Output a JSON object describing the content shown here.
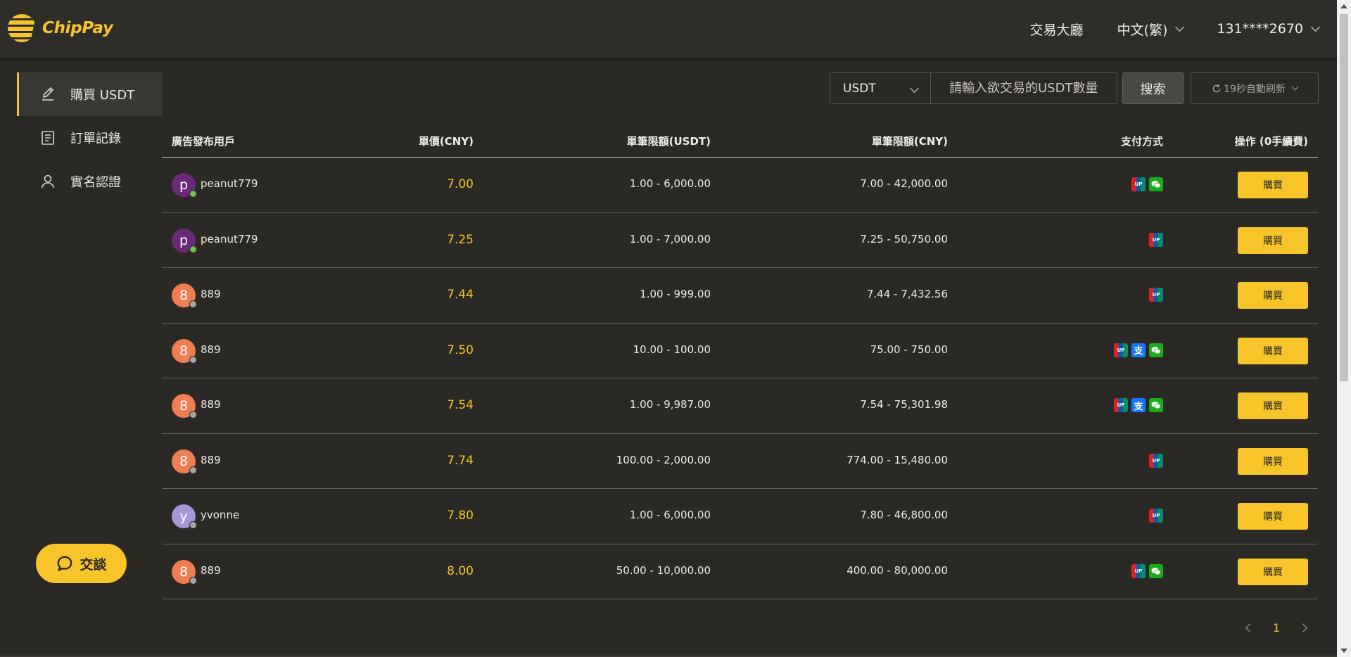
{
  "brand": {
    "name": "ChipPay",
    "accent": "#f7c52a"
  },
  "header": {
    "nav_trading_hall": "交易大廳",
    "language": "中文(繁)",
    "account": "131****2670"
  },
  "sidebar": {
    "items": [
      {
        "label": "購買 USDT",
        "icon": "edit-icon",
        "active": true
      },
      {
        "label": "訂單記錄",
        "icon": "document-icon",
        "active": false
      },
      {
        "label": "實名認證",
        "icon": "user-icon",
        "active": false
      }
    ]
  },
  "chat": {
    "label": "交談"
  },
  "filters": {
    "currency": "USDT",
    "amount_placeholder": "請輸入欲交易的USDT數量",
    "search_label": "搜索",
    "refresh_label": "19秒自動刷新"
  },
  "table": {
    "headers": {
      "advertiser": "廣告發布用戶",
      "price": "單價(CNY)",
      "limit_usdt": "單筆限額(USDT)",
      "limit_cny": "單筆限額(CNY)",
      "payment": "支付方式",
      "action": "操作 (0手續費)"
    },
    "buy_label": "購買",
    "rows": [
      {
        "initial": "p",
        "avatar_color": "#6b2a78",
        "online": true,
        "user": "peanut779",
        "price": "7.00",
        "limit_usdt": "1.00 - 6,000.00",
        "limit_cny": "7.00 - 42,000.00",
        "payments": [
          "unionpay",
          "wechat"
        ]
      },
      {
        "initial": "p",
        "avatar_color": "#6b2a78",
        "online": true,
        "user": "peanut779",
        "price": "7.25",
        "limit_usdt": "1.00 - 7,000.00",
        "limit_cny": "7.25 - 50,750.00",
        "payments": [
          "unionpay"
        ]
      },
      {
        "initial": "8",
        "avatar_color": "#ee7d52",
        "online": false,
        "user": "889",
        "price": "7.44",
        "limit_usdt": "1.00 - 999.00",
        "limit_cny": "7.44 - 7,432.56",
        "payments": [
          "unionpay"
        ]
      },
      {
        "initial": "8",
        "avatar_color": "#ee7d52",
        "online": false,
        "user": "889",
        "price": "7.50",
        "limit_usdt": "10.00 - 100.00",
        "limit_cny": "75.00 - 750.00",
        "payments": [
          "unionpay",
          "alipay",
          "wechat"
        ]
      },
      {
        "initial": "8",
        "avatar_color": "#ee7d52",
        "online": false,
        "user": "889",
        "price": "7.54",
        "limit_usdt": "1.00 - 9,987.00",
        "limit_cny": "7.54 - 75,301.98",
        "payments": [
          "unionpay",
          "alipay",
          "wechat"
        ]
      },
      {
        "initial": "8",
        "avatar_color": "#ee7d52",
        "online": false,
        "user": "889",
        "price": "7.74",
        "limit_usdt": "100.00 - 2,000.00",
        "limit_cny": "774.00 - 15,480.00",
        "payments": [
          "unionpay"
        ]
      },
      {
        "initial": "y",
        "avatar_color": "#a996d6",
        "online": false,
        "user": "yvonne",
        "price": "7.80",
        "limit_usdt": "1.00 - 6,000.00",
        "limit_cny": "7.80 - 46,800.00",
        "payments": [
          "unionpay"
        ]
      },
      {
        "initial": "8",
        "avatar_color": "#ee7d52",
        "online": false,
        "user": "889",
        "price": "8.00",
        "limit_usdt": "50.00 - 10,000.00",
        "limit_cny": "400.00 - 80,000.00",
        "payments": [
          "unionpay",
          "wechat"
        ]
      }
    ]
  },
  "pagination": {
    "current": "1"
  },
  "status_colors": {
    "online": "#6cc24a",
    "offline": "#a6a6a6"
  }
}
